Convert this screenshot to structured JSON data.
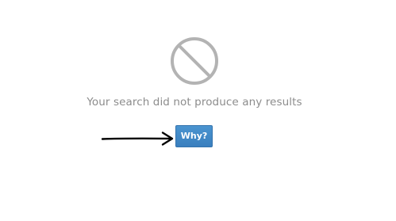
{
  "empty_state": {
    "icon": "no-results-icon",
    "message": "Your search did not produce any results",
    "why_button_label": "Why?"
  },
  "annotation": {
    "icon": "arrow-right-icon"
  },
  "colors": {
    "icon": "#b3b3b3",
    "message_text": "#8c8c8c",
    "button_bg": "#3f87c6",
    "button_text": "#ffffff",
    "arrow": "#000000"
  }
}
